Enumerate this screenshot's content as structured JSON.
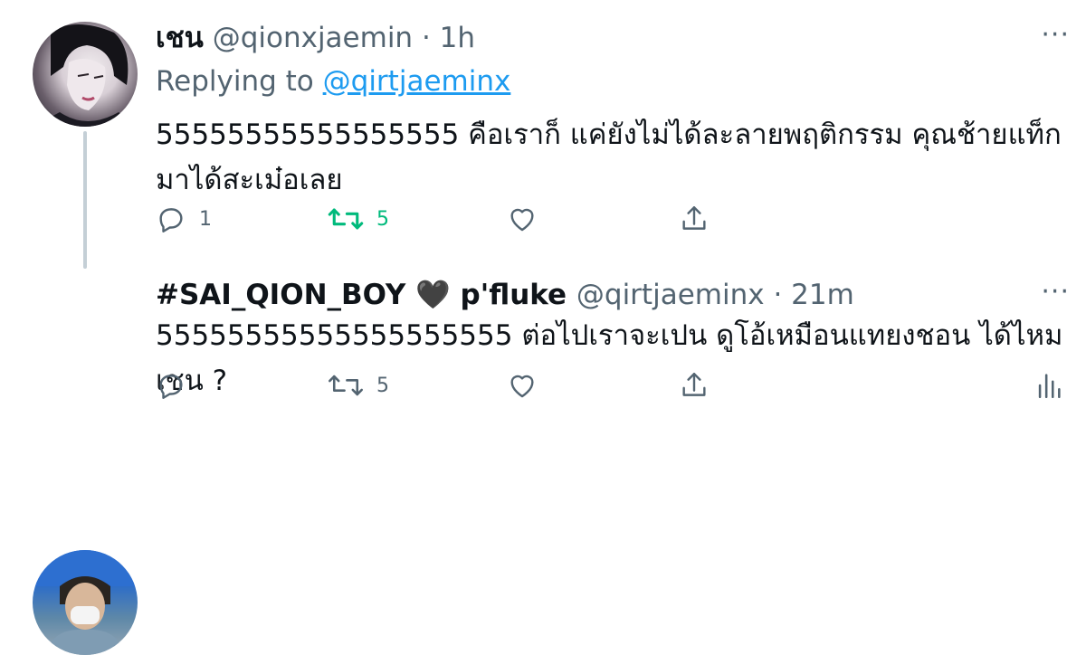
{
  "tweets": [
    {
      "name": "เชน",
      "handle": "@qionxjaemin",
      "separator": "·",
      "time": "1h",
      "more": "···",
      "replying_prefix": "Replying to",
      "replying_handle": "@qirtjaeminx",
      "text": "55555555555555555 คือเราก็ แค่ยังไม่ได้ละลายพฤติกรรม คุณช้ายแท็กมาได้สะเม๋อเลย",
      "actions": {
        "replies": "1",
        "retweets": "5",
        "retweeted": true
      }
    },
    {
      "name": "#SAI_QION_BOY",
      "name_emoji": "🖤",
      "display_suffix": "p'fluke",
      "handle": "@qirtjaeminx",
      "separator": "·",
      "time": "21m",
      "more": "···",
      "text": "55555555555555555555 ต่อไปเราจะเปน ดูโอ้เหมือนแทยงชอน ได้ไหมเชน ?",
      "actions": {
        "retweets": "5",
        "retweeted": false
      }
    }
  ],
  "colors": {
    "accent": "#1d9bf0",
    "retweet_active": "#00ba7c",
    "secondary": "#536471",
    "thread_line": "#c4cfd6"
  },
  "icons": [
    "reply-icon",
    "retweet-icon",
    "like-icon",
    "share-icon",
    "analytics-icon",
    "more-icon"
  ]
}
